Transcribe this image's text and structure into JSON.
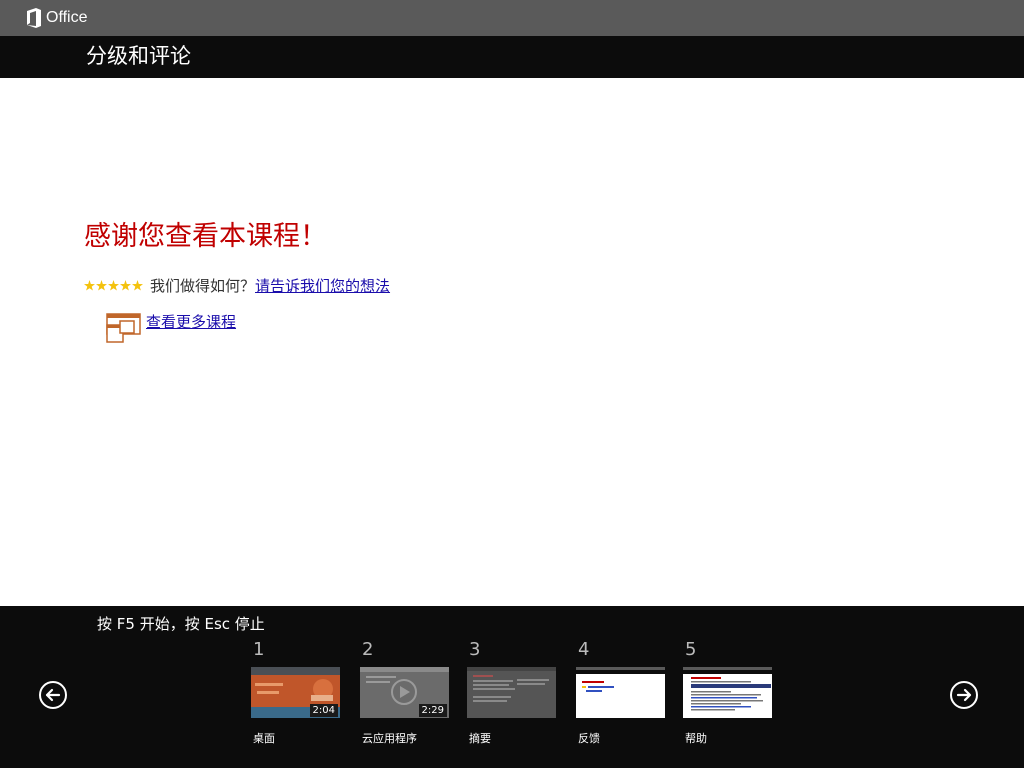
{
  "app": {
    "brand": "Office"
  },
  "page": {
    "title": "分级和评论"
  },
  "main": {
    "heading": "感谢您查看本课程！",
    "rating": {
      "stars": 5,
      "question": "我们做得如何？",
      "feedback_link": "请告诉我们您的想法"
    },
    "more_courses_link": "查看更多课程"
  },
  "bottom": {
    "hint": "按 F5 开始，按 Esc 停止",
    "slides": [
      {
        "number": "1",
        "label": "桌面",
        "duration": "2:04"
      },
      {
        "number": "2",
        "label": "云应用程序",
        "duration": "2:29"
      },
      {
        "number": "3",
        "label": "摘要"
      },
      {
        "number": "4",
        "label": "反馈"
      },
      {
        "number": "5",
        "label": "帮助"
      }
    ]
  },
  "colors": {
    "top_bar": "#5a5a5a",
    "title_bar": "#0c0c0c",
    "heading": "#c00000",
    "link": "#1a0dab",
    "star": "#f4c20d",
    "course_icon": "#c0662a"
  }
}
